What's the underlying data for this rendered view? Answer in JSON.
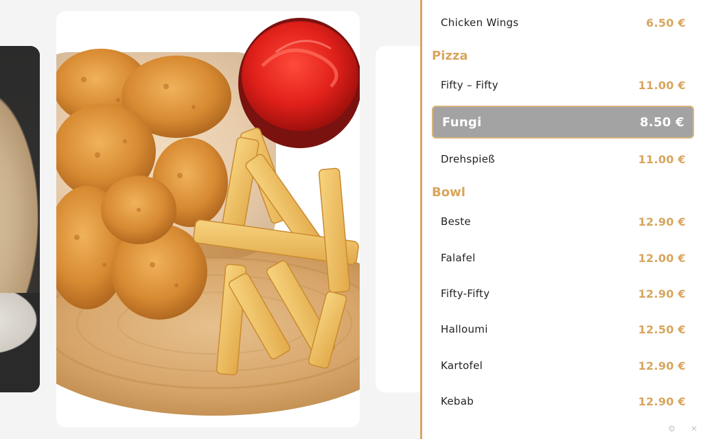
{
  "menu": {
    "items_top": [
      {
        "name": "Chicken Wings",
        "price": "6.50 €"
      }
    ],
    "categories": [
      {
        "title": "Pizza",
        "items": [
          {
            "name": "Fifty – Fifty",
            "price": "11.00 €"
          },
          {
            "name": "Fungi",
            "price": "8.50 €",
            "selected": true
          },
          {
            "name": "Drehspieß",
            "price": "11.00 €"
          }
        ]
      },
      {
        "title": "Bowl",
        "items": [
          {
            "name": "Beste",
            "price": "12.90 €"
          },
          {
            "name": "Falafel",
            "price": "12.00 €"
          },
          {
            "name": "Fifty-Fifty",
            "price": "12.90 €"
          },
          {
            "name": "Halloumi",
            "price": "12.50 €"
          },
          {
            "name": "Kartofel",
            "price": "12.90 €"
          },
          {
            "name": "Kebab",
            "price": "12.90 €"
          }
        ]
      }
    ]
  },
  "colors": {
    "accent": "#d8a55e",
    "selected_bg": "#a3a3a3",
    "background": "#f4f4f4"
  },
  "icons": {
    "settings": "gear-icon",
    "close": "close-icon"
  }
}
